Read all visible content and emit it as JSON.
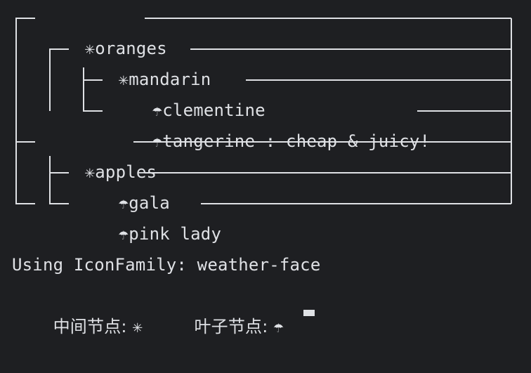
{
  "tree": {
    "rows": [
      {
        "glyph": "✳",
        "label": "oranges"
      },
      {
        "glyph": "✳",
        "label": "mandarin"
      },
      {
        "glyph": "☂",
        "label": "clementine"
      },
      {
        "glyph": "☂",
        "label": "tangerine : cheap & juicy!"
      },
      {
        "glyph": "✳",
        "label": "apples"
      },
      {
        "glyph": "☂",
        "label": "gala"
      },
      {
        "glyph": "☂",
        "label": "pink lady"
      }
    ]
  },
  "footer": {
    "icon_family_label": "Using IconFamily: weather-face",
    "middle_node_label": "中间节点: ",
    "middle_node_glyph": "✳",
    "leaf_node_label": "叶子节点: ",
    "leaf_node_glyph": "☂"
  },
  "colors": {
    "background": "#1e1f22",
    "foreground": "#dfe1e5"
  }
}
